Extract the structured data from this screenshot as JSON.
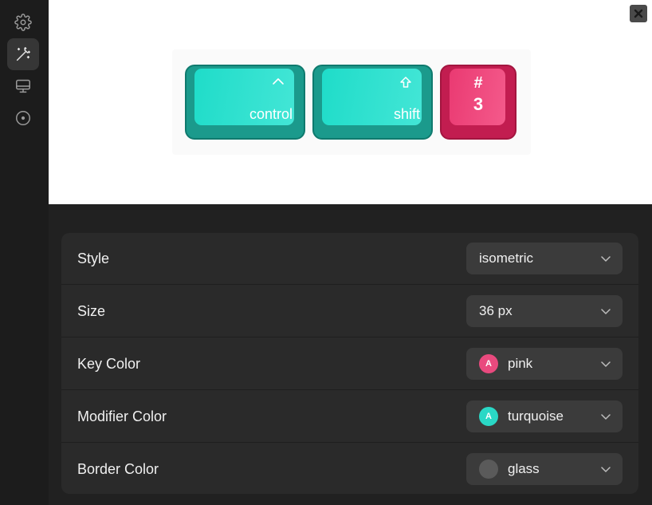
{
  "sidebar": {
    "items": [
      {
        "icon": "gear-icon",
        "active": false
      },
      {
        "icon": "magic-wand-icon",
        "active": true
      },
      {
        "icon": "monitor-icon",
        "active": false
      },
      {
        "icon": "disc-icon",
        "active": false
      }
    ]
  },
  "preview": {
    "close_icon": "close-icon",
    "keys": [
      {
        "type": "modifier",
        "symbol": "^",
        "label": "control"
      },
      {
        "type": "modifier",
        "symbol": "⇧",
        "label": "shift"
      },
      {
        "type": "key",
        "top": "#",
        "bottom": "3"
      }
    ]
  },
  "settings": {
    "rows": [
      {
        "label": "Style",
        "value": "isometric",
        "swatch": null
      },
      {
        "label": "Size",
        "value": "36 px",
        "swatch": null
      },
      {
        "label": "Key Color",
        "value": "pink",
        "swatch": {
          "letter": "A",
          "color": "#e94a7e"
        }
      },
      {
        "label": "Modifier Color",
        "value": "turquoise",
        "swatch": {
          "letter": "A",
          "color": "#2ad8c6"
        }
      },
      {
        "label": "Border Color",
        "value": "glass",
        "swatch": {
          "letter": "",
          "color": "#5a5a5a"
        }
      }
    ]
  },
  "colors": {
    "modifier_key": "#1fdcc9",
    "regular_key": "#ea3a72",
    "panel_bg": "#2a2a2a",
    "dropdown_bg": "#3b3b3b"
  }
}
